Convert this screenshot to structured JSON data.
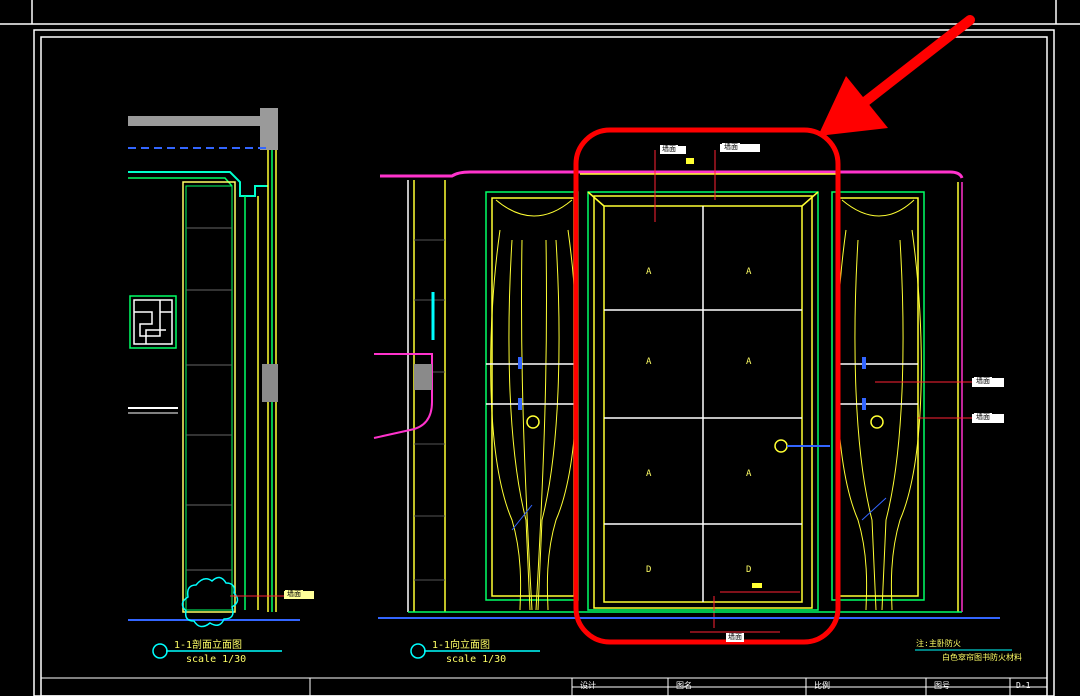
{
  "drawing": {
    "colors": {
      "background": "#000000",
      "frame": "#ffffff",
      "wall_green": "#00ff66",
      "panel_yellow": "#ffff33",
      "trim_magenta": "#ff33cc",
      "leader_red": "#ff2233",
      "dim_cyan": "#00ffff",
      "highlight_red": "#ff0000",
      "grey_block": "#888888"
    },
    "views": [
      {
        "id": "section",
        "title": "1-1剖面立面图",
        "scale": "scale 1/30"
      },
      {
        "id": "elevation",
        "title": "1-1向立面图",
        "scale": "scale 1/30"
      }
    ],
    "notes": [
      "注:主卧防火",
      "白色窣帘图书防火材料"
    ],
    "door_marks": [
      "A",
      "A",
      "A",
      "A",
      "A",
      "A",
      "D",
      "D"
    ],
    "callouts": [
      "墙面",
      "墙面",
      "墙面",
      "墙面",
      "墙面",
      "墙面"
    ],
    "title_block": [
      "设计",
      "图名",
      "比例",
      "图号",
      "D-1"
    ],
    "highlight": {
      "shape": "rounded-rectangle",
      "arrow": "pointing-down-left"
    }
  }
}
